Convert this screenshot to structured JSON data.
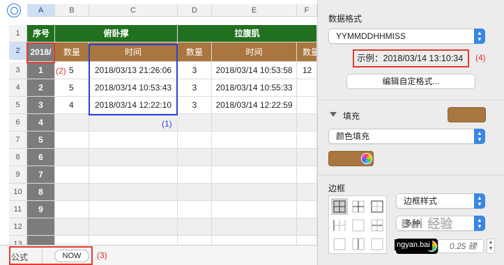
{
  "sheet": {
    "columns": [
      "A",
      "B",
      "C",
      "D",
      "E",
      "F"
    ],
    "rows": [
      "1",
      "2",
      "3",
      "4",
      "5",
      "6",
      "7",
      "8",
      "9",
      "10",
      "11",
      "12",
      "13"
    ],
    "header_row1": {
      "index_label": "序号",
      "group1": "俯卧撑",
      "group2": "拉腹肌"
    },
    "header_row2": {
      "a_value": "2018/",
      "qty": "数量",
      "time": "时间",
      "qty2": "数量",
      "time2": "时间",
      "qty3": "数量"
    },
    "data": [
      {
        "seq": "1",
        "qty": "5",
        "time": "2018/03/13 21:26:06",
        "qty2": "3",
        "time2": "2018/03/14 10:53:58",
        "qty3": "12"
      },
      {
        "seq": "2",
        "qty": "5",
        "time": "2018/03/14 10:53:43",
        "qty2": "3",
        "time2": "2018/03/14 10:55:33",
        "qty3": ""
      },
      {
        "seq": "3",
        "qty": "4",
        "time": "2018/03/14 12:22:10",
        "qty2": "3",
        "time2": "2018/03/14 12:22:59",
        "qty3": ""
      },
      {
        "seq": "4"
      },
      {
        "seq": "5"
      },
      {
        "seq": "6"
      },
      {
        "seq": "7"
      },
      {
        "seq": "8"
      },
      {
        "seq": "9"
      }
    ],
    "marks": {
      "m1": "(1)",
      "m2": "(2)",
      "m3": "(3)",
      "m4": "(4)"
    }
  },
  "formula_bar": {
    "label": "公式",
    "value": "NOW"
  },
  "panel": {
    "data_format_title": "数据格式",
    "format_value": "YYMMDDHHMISS",
    "example_label": "示例：",
    "example_value": "2018/03/14 13:10:34",
    "edit_custom_button": "编辑自定格式...",
    "fill_title": "填充",
    "fill_type": "颜色填充",
    "border_title": "边框",
    "border_style": "边框样式",
    "multi": "多种",
    "line_width": "0.25 磅",
    "watermark": "Bai 经验",
    "watermark_sub": "ngyan.bai"
  },
  "colors": {
    "header_green": "#207020",
    "header_brown": "#a9763f",
    "index_gray": "#7c7c7c",
    "accent_blue": "#3a86e3",
    "highlight_red": "#e23b2e"
  }
}
